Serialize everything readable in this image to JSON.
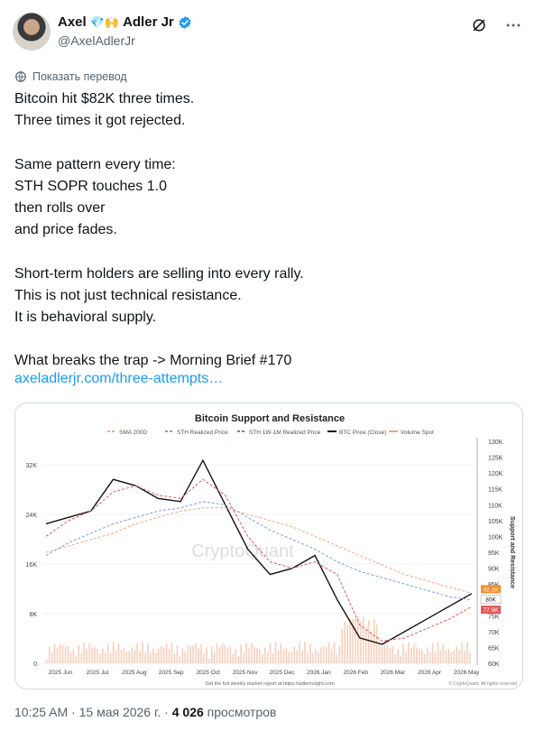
{
  "author": {
    "name": "Axel",
    "emoji": "💎🙌",
    "name_suffix": "Adler Jr",
    "handle": "@AxelAdlerJr"
  },
  "translate_label": "Показать перевод",
  "tweet_lines": [
    "Bitcoin hit $82K three times.",
    "Three times it got rejected.",
    "",
    "Same pattern every time:",
    "STH SOPR touches 1.0",
    "then rolls over",
    "and price fades.",
    "",
    "Short-term holders are selling into every rally.",
    "This is not just technical resistance.",
    "It is behavioral supply.",
    "",
    "What breaks the trap -> Morning Brief #170"
  ],
  "link_text": "axeladlerjr.com/three-attempts…",
  "chart_data": {
    "type": "line",
    "title": "Bitcoin Support and Resistance",
    "legend": [
      "SMA 200D",
      "STH Realized Price",
      "STH 1W-1M Realized Price",
      "BTC Price (Close)",
      "Volume Spot"
    ],
    "legend_placement": "top",
    "x_ticks": [
      "2025 Jun",
      "2025 Jul",
      "2025 Aug",
      "2025 Sep",
      "2025 Oct",
      "2025 Nov",
      "2025 Dec",
      "2026 Jan",
      "2026 Feb",
      "2026 Mar",
      "2026 Apr",
      "2026 May"
    ],
    "left_ticks": [
      "32K",
      "24K",
      "16K",
      "8K",
      "0"
    ],
    "right_ticks": [
      "130K",
      "125K",
      "120K",
      "115K",
      "110K",
      "105K",
      "100K",
      "95K",
      "90K",
      "85K",
      "80K",
      "75K",
      "70K",
      "65K",
      "60K"
    ],
    "ylabel_right": "Support and Resistance",
    "ylim_right": [
      60000,
      130000
    ],
    "ylim_left": [
      0,
      34000
    ],
    "value_tags": [
      {
        "label": "82.1K",
        "color": "#f28e2b"
      },
      {
        "label": "80K",
        "color": "#ffffff"
      },
      {
        "label": "77.9K",
        "color": "#e15759"
      }
    ],
    "watermark": "CryptoQuant",
    "footer": "Get the full weekly market report at https://adlerinsight.com",
    "footer_right": "© CryptoQuant. All rights reserved",
    "series": [
      {
        "name": "BTC Price (Close)",
        "color": "#111111",
        "values": [
          104000,
          106000,
          108000,
          118000,
          116000,
          112000,
          111000,
          124000,
          110000,
          96000,
          88000,
          90000,
          94000,
          80000,
          68000,
          66000,
          70000,
          74000,
          78000,
          82000
        ]
      },
      {
        "name": "SMA 200D",
        "color": "#f4a582",
        "values": [
          95000,
          97000,
          99000,
          101000,
          104000,
          106000,
          108000,
          109000,
          109000,
          107000,
          105000,
          103000,
          100000,
          97000,
          94000,
          91000,
          88000,
          86000,
          84000,
          82100
        ]
      },
      {
        "name": "STH Realized Price",
        "color": "#7b9fe0",
        "values": [
          94000,
          98000,
          101000,
          104000,
          106000,
          108000,
          109000,
          111000,
          110000,
          106000,
          102000,
          99000,
          96000,
          92000,
          89000,
          87000,
          85000,
          83000,
          81000,
          80000
        ]
      },
      {
        "name": "STH 1W-1M Realized Price",
        "color": "#e15759",
        "values": [
          100000,
          105000,
          108000,
          114000,
          116000,
          113000,
          112000,
          118000,
          113000,
          100000,
          92000,
          90000,
          92000,
          88000,
          72000,
          67000,
          68000,
          71000,
          74000,
          77900
        ]
      }
    ]
  },
  "meta": {
    "time": "10:25 AM",
    "dot": "·",
    "date": "15 мая 2026 г.",
    "views_count": "4 026",
    "views_label": "просмотров"
  }
}
